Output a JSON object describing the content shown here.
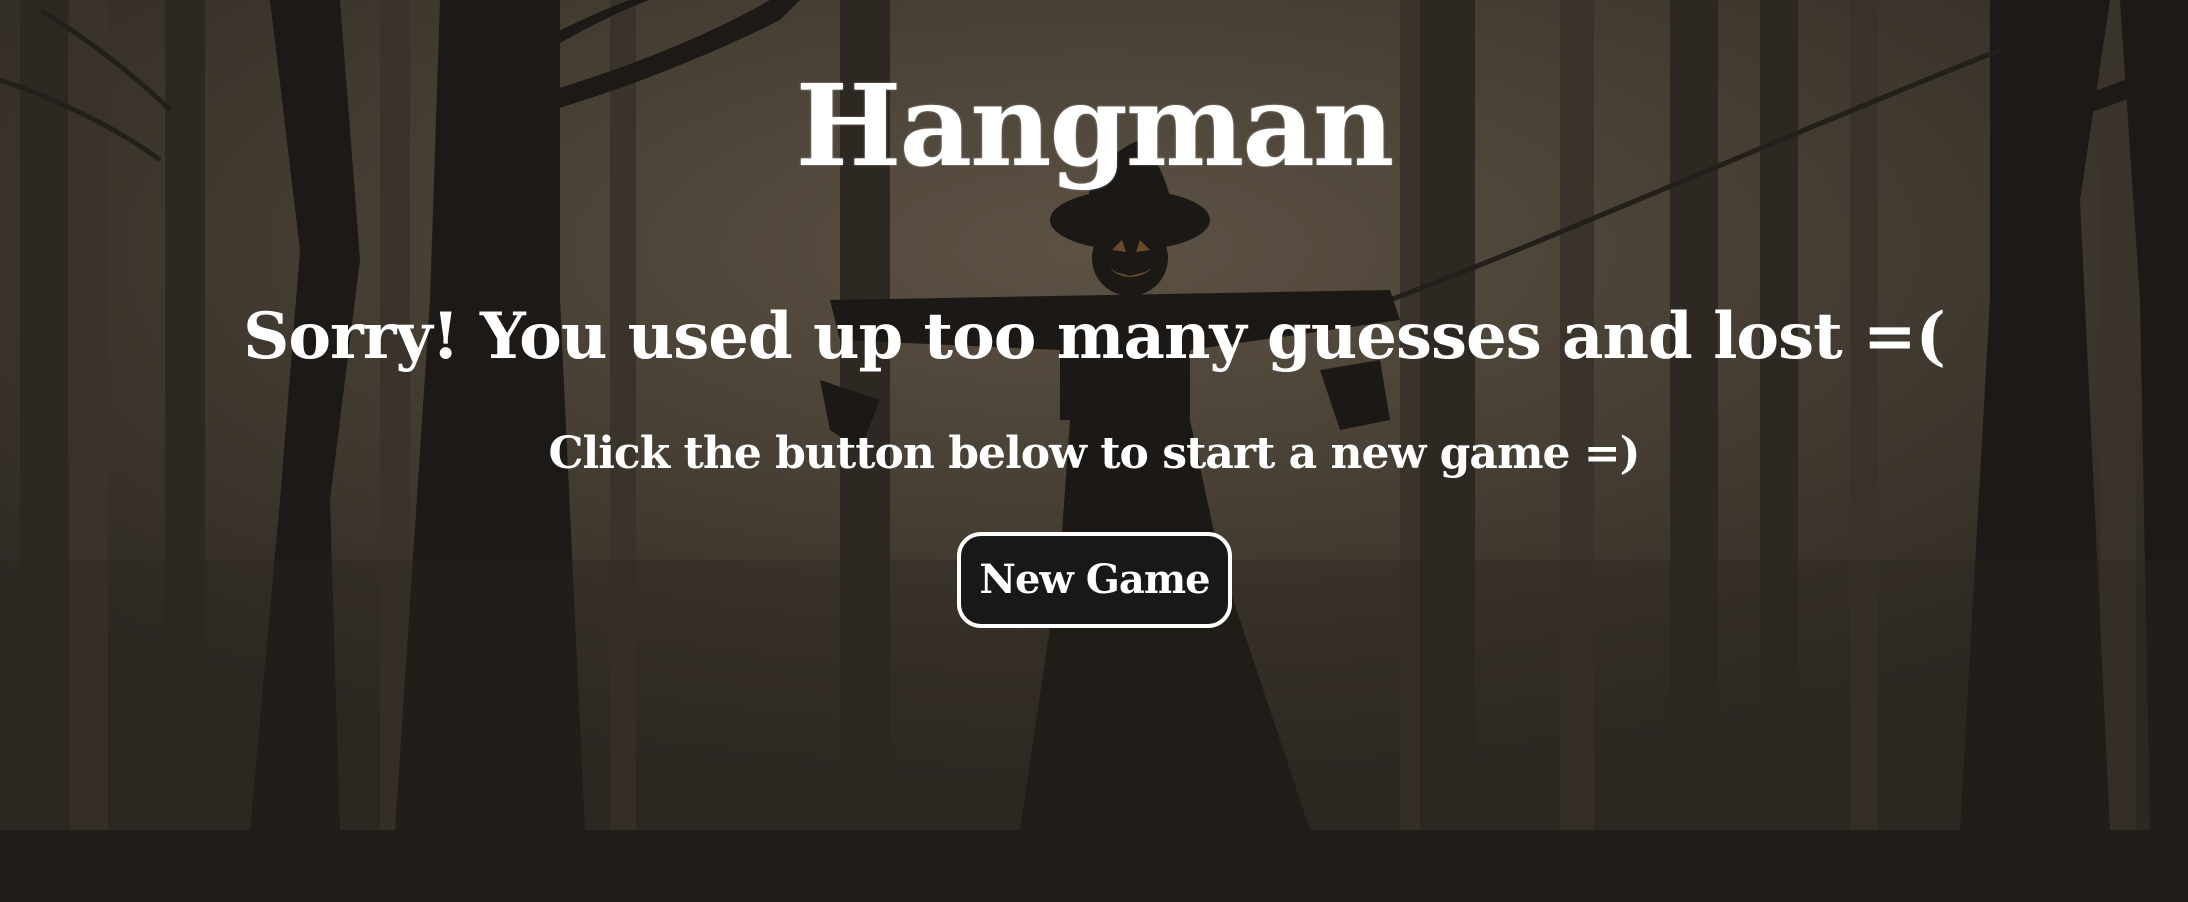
{
  "game": {
    "title": "Hangman",
    "result_message": "Sorry! You used up too many guesses and lost =(",
    "instruction": "Click the button below to start a new game =)",
    "new_game_label": "New Game"
  },
  "background": {
    "scene": "dark forest with scarecrow silhouette",
    "colors": {
      "sky": "#4a4236",
      "trees": "#1c1916",
      "ground": "#1f1c19",
      "text": "#ffffff"
    }
  }
}
